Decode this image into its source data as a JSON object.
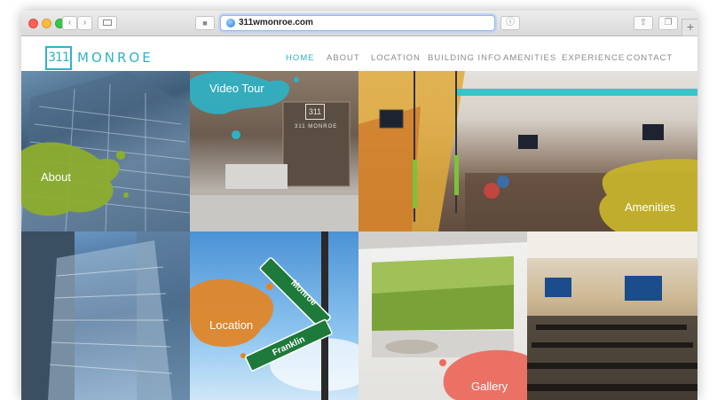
{
  "browser": {
    "url": "311wmonroe.com",
    "share_icon": "share-icon",
    "tabs_icon": "tabs-icon",
    "new_tab": "+"
  },
  "logo": {
    "mark": "311",
    "text": "MONROE"
  },
  "nav": {
    "items": [
      "HOME",
      "ABOUT",
      "LOCATION",
      "BUILDING INFO",
      "AMENITIES",
      "EXPERIENCE",
      "CONTACT"
    ],
    "active": "HOME"
  },
  "tiles": {
    "about": "About",
    "video": "Video Tour",
    "amenities": "Amenities",
    "location": "Location",
    "gallery": "Gallery"
  },
  "signs": {
    "monroe": "Monroe",
    "franklin": "Franklin"
  },
  "lobby_sign": {
    "mark": "311",
    "text": "311 MONROE"
  },
  "colors": {
    "teal": "#2fb1c4",
    "green": "#8dae2a",
    "orange": "#e0862a",
    "olive": "#c9b52a",
    "coral": "#ec6a5e"
  }
}
